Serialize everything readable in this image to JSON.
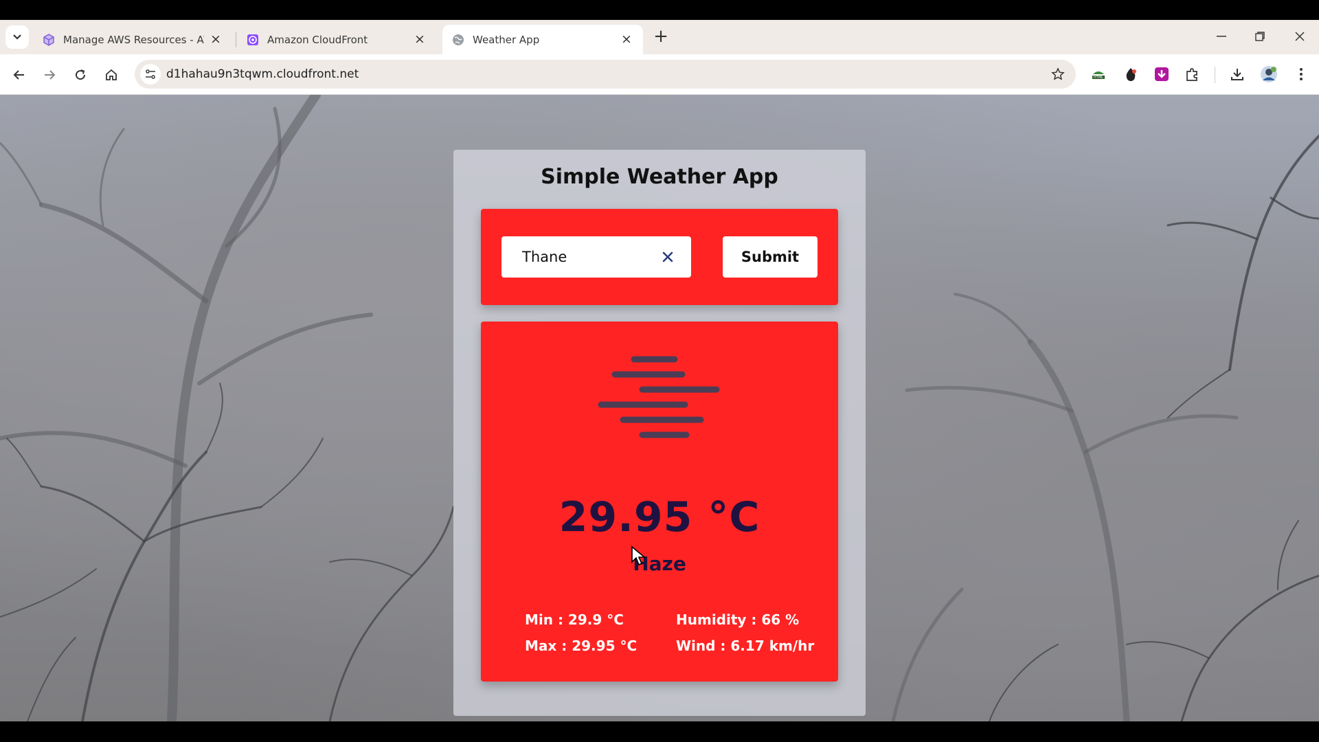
{
  "browser": {
    "tabs": [
      {
        "title": "Manage AWS Resources - AWS",
        "icon": "aws-cube-icon",
        "active": false
      },
      {
        "title": "Amazon CloudFront",
        "icon": "cloudfront-icon",
        "active": false
      },
      {
        "title": "Weather App",
        "icon": "globe-icon",
        "active": true
      }
    ],
    "url": "d1hahau9n3tqwm.cloudfront.net",
    "accent": "#f0ebe6"
  },
  "app": {
    "title": "Simple Weather App",
    "search": {
      "value": "Thane",
      "submit_label": "Submit"
    },
    "weather": {
      "icon": "haze-icon",
      "temperature": "29.95 °C",
      "condition": "Haze",
      "min": "Min : 29.9 °C",
      "max": "Max : 29.95 °C",
      "humidity": "Humidity : 66 %",
      "wind": "Wind : 6.17 km/hr"
    },
    "card_color": "#ff2323",
    "text_dark": "#1f1240"
  }
}
